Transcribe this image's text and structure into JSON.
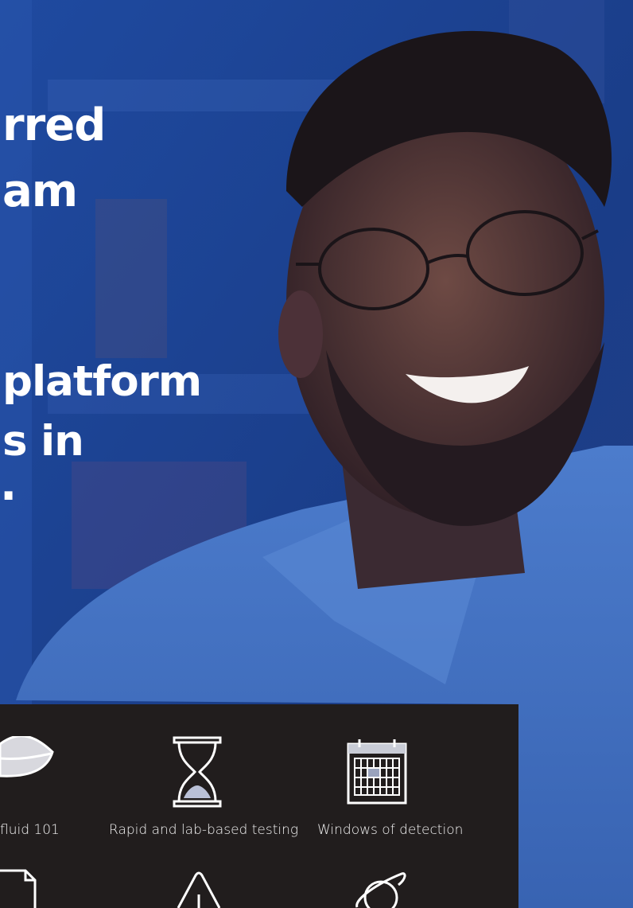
{
  "headline": {
    "line1": "rred",
    "line2": "am",
    "line3": "platform",
    "line4": "s in",
    "line5": "."
  },
  "features": [
    {
      "label": "fluid 101",
      "icon": "lips-icon"
    },
    {
      "label": "Rapid and lab-based testing",
      "icon": "hourglass-icon"
    },
    {
      "label": "Windows of detection",
      "icon": "calendar-icon"
    },
    {
      "label": "",
      "icon": "document-icon"
    },
    {
      "label": "",
      "icon": "warning-icon"
    },
    {
      "label": "",
      "icon": "planet-icon"
    }
  ],
  "colors": {
    "hero_blue": "#1b3f8e",
    "panel_dark": "#211d1d",
    "text_white": "#ffffff"
  }
}
